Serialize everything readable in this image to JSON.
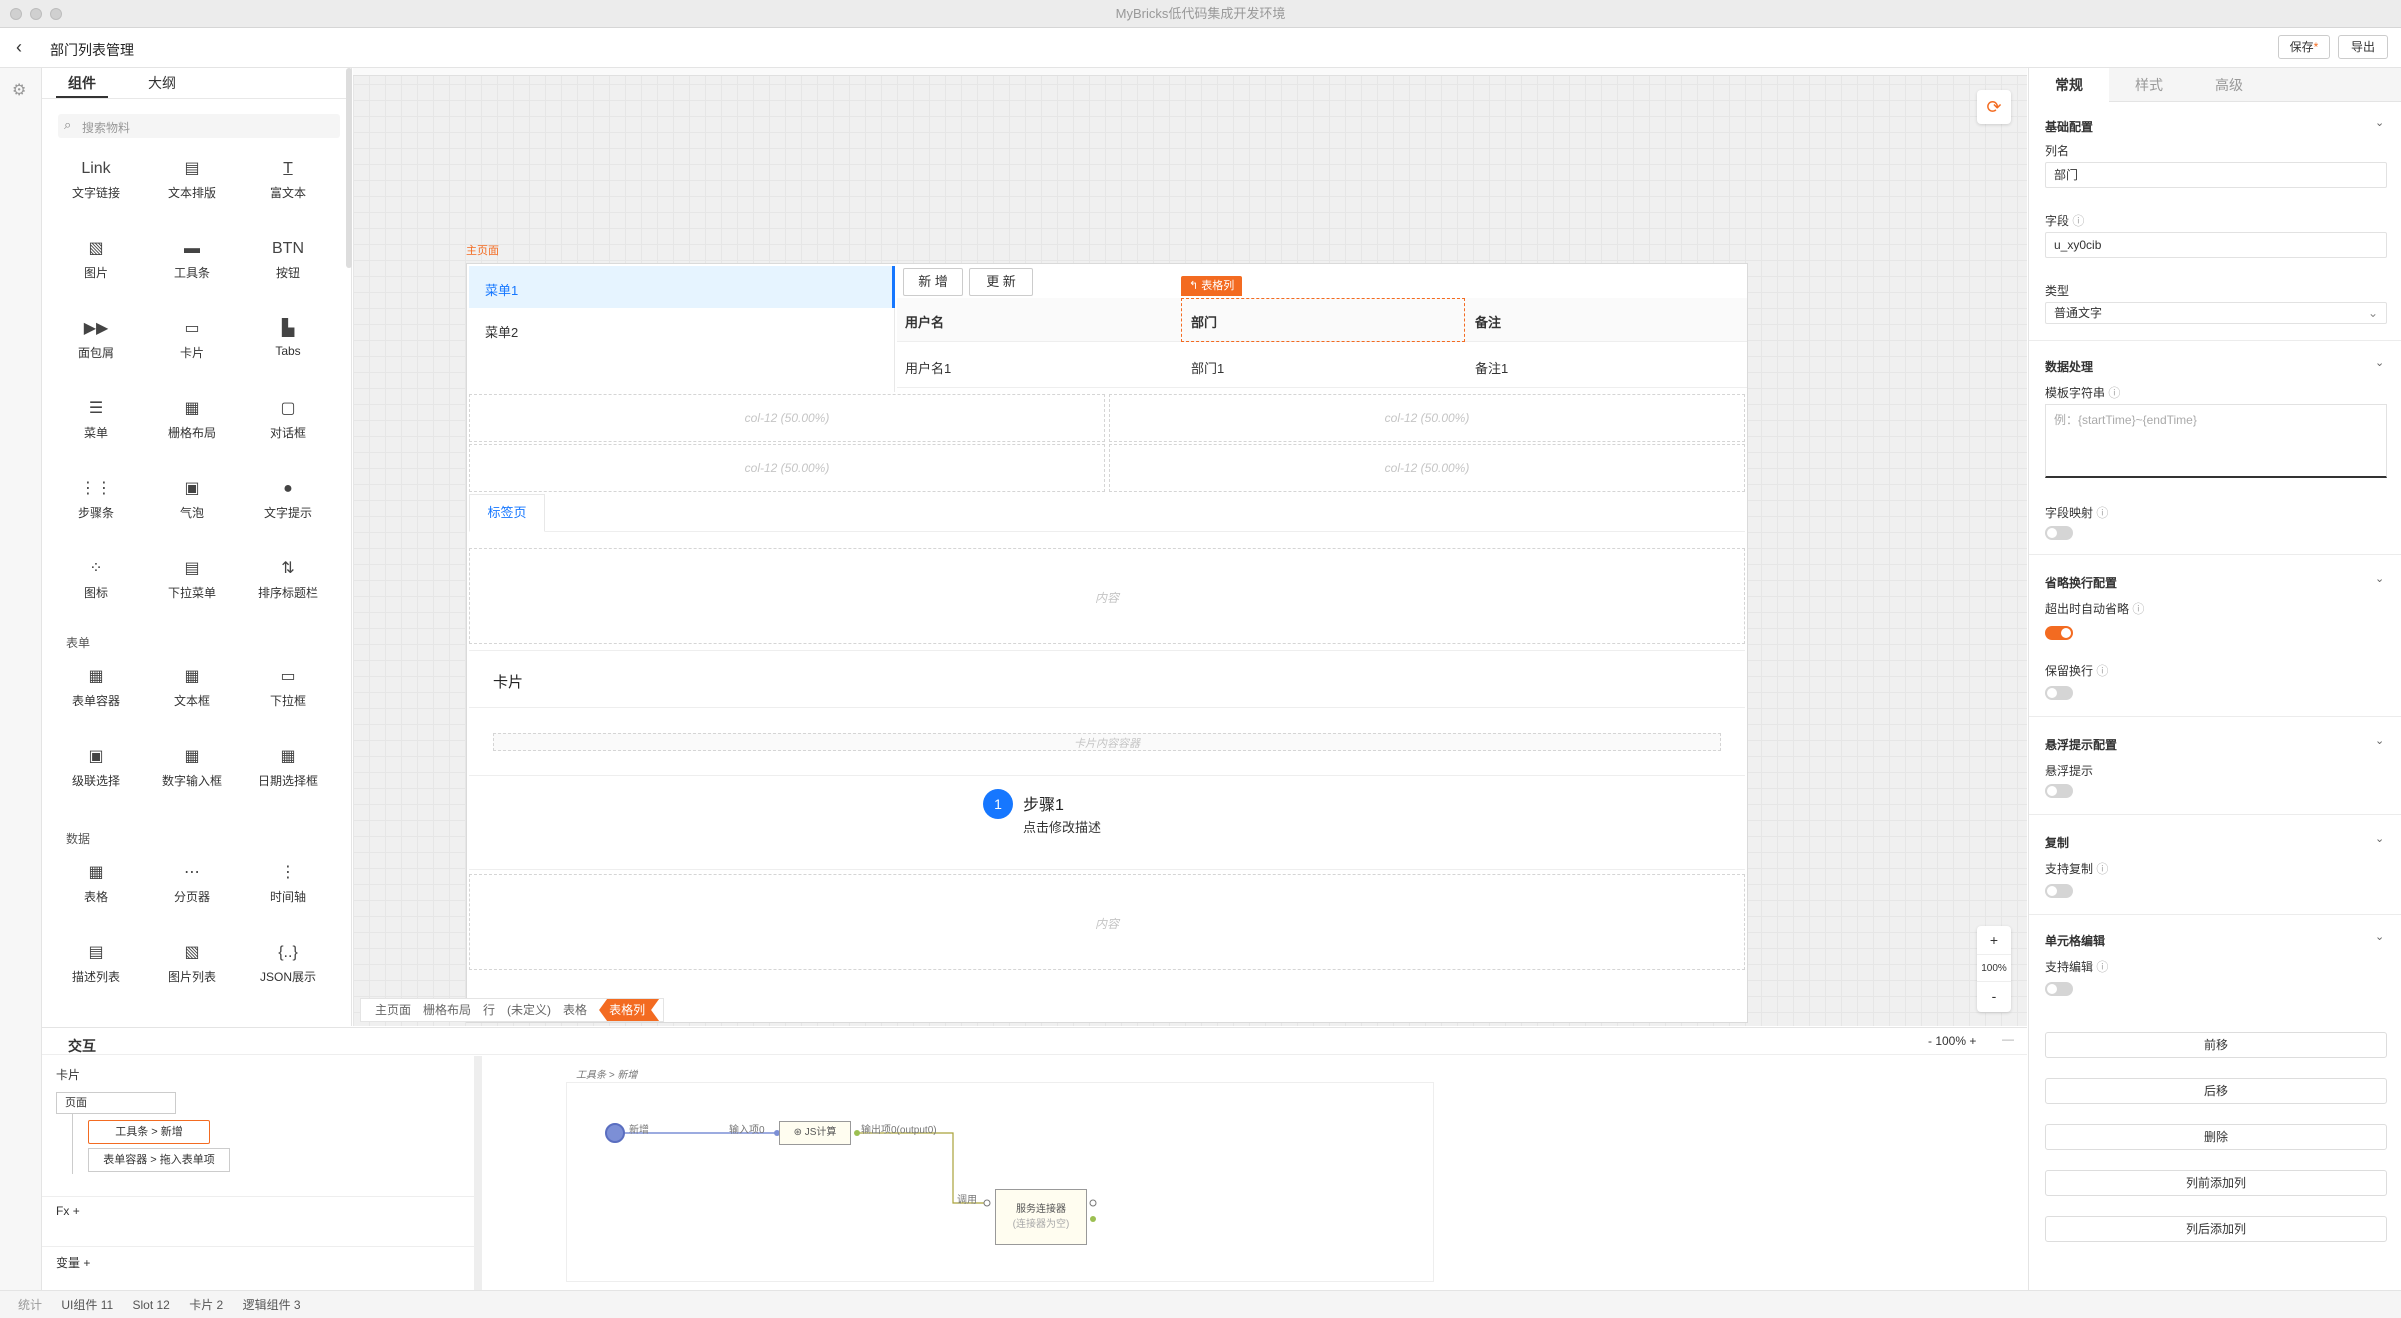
{
  "window": {
    "title": "MyBricks低代码集成开发环境"
  },
  "header": {
    "back_icon": "chevron-left-icon",
    "page_title": "部门列表管理",
    "save_label": "保存",
    "export_label": "导出"
  },
  "left_panel": {
    "tabs": [
      "组件",
      "大纲"
    ],
    "search_placeholder": "搜索物料",
    "components": [
      {
        "label": "文字链接",
        "icon": "Link"
      },
      {
        "label": "文本排版",
        "icon": "▤"
      },
      {
        "label": "富文本",
        "icon": "T̲"
      },
      {
        "label": "图片",
        "icon": "▧"
      },
      {
        "label": "工具条",
        "icon": "▬"
      },
      {
        "label": "按钮",
        "icon": "BTN"
      },
      {
        "label": "面包屑",
        "icon": "▶▶"
      },
      {
        "label": "卡片",
        "icon": "▭"
      },
      {
        "label": "Tabs",
        "icon": "▙"
      },
      {
        "label": "菜单",
        "icon": "☰"
      },
      {
        "label": "栅格布局",
        "icon": "▦"
      },
      {
        "label": "对话框",
        "icon": "▢"
      },
      {
        "label": "步骤条",
        "icon": "⋮⋮"
      },
      {
        "label": "气泡",
        "icon": "▣"
      },
      {
        "label": "文字提示",
        "icon": "●"
      },
      {
        "label": "图标",
        "icon": "⁘"
      },
      {
        "label": "下拉菜单",
        "icon": "▤"
      },
      {
        "label": "排序标题栏",
        "icon": "⇅"
      }
    ],
    "form_section": "表单",
    "form_components": [
      {
        "label": "表单容器",
        "icon": "▦"
      },
      {
        "label": "文本框",
        "icon": "▦"
      },
      {
        "label": "下拉框",
        "icon": "▭"
      },
      {
        "label": "级联选择",
        "icon": "▣"
      },
      {
        "label": "数字输入框",
        "icon": "▦"
      },
      {
        "label": "日期选择框",
        "icon": "▦"
      }
    ],
    "data_section": "数据",
    "data_components": [
      {
        "label": "表格",
        "icon": "▦"
      },
      {
        "label": "分页器",
        "icon": "⋯"
      },
      {
        "label": "时间轴",
        "icon": "⋮"
      },
      {
        "label": "描述列表",
        "icon": "▤"
      },
      {
        "label": "图片列表",
        "icon": "▧"
      },
      {
        "label": "JSON展示",
        "icon": "{..}"
      }
    ]
  },
  "canvas": {
    "page_label": "主页面",
    "menu": [
      "菜单1",
      "菜单2"
    ],
    "toolbar": [
      "新 增",
      "更 新"
    ],
    "table_col_tag": "表格列",
    "table_headers": [
      "用户名",
      "部门",
      "备注"
    ],
    "table_row": [
      "用户名1",
      "部门1",
      "备注1"
    ],
    "grid_cells": [
      "col-12 (50.00%)",
      "col-12 (50.00%)",
      "col-12 (50.00%)",
      "col-12 (50.00%)"
    ],
    "tab_label": "标签页",
    "content_placeholder": "内容",
    "card_title": "卡片",
    "card_content_placeholder": "卡片内容容器",
    "step_number": "1",
    "step_title": "步骤1",
    "step_desc": "点击修改描述",
    "content_placeholder2": "内容",
    "breadcrumb": [
      "主页面",
      "栅格布局",
      "行",
      "(未定义)",
      "表格",
      "表格列"
    ],
    "zoom_in": "+",
    "zoom_level": "100%",
    "zoom_out": "-"
  },
  "interaction": {
    "title": "交互",
    "zoom": "- 100% +",
    "tree_section": "卡片",
    "tree_root": "页面",
    "tree_items": [
      "工具条 > 新增",
      "表单容器 > 拖入表单项"
    ],
    "fx_label": "Fx",
    "var_label": "变量",
    "flow_title": "工具条 > 新增",
    "node_start_label": "新增",
    "node_input_label": "输入项0",
    "node_js": "JS计算",
    "node_output_label": "输出项0(output0)",
    "node_call_label": "调用",
    "node_service": "服务连接器",
    "node_service_sub": "(连接器为空)"
  },
  "right_panel": {
    "tabs": [
      "常规",
      "样式",
      "高级"
    ],
    "basic_section": "基础配置",
    "col_name_label": "列名",
    "col_name_value": "部门",
    "field_label": "字段",
    "field_value": "u_xy0cib",
    "type_label": "类型",
    "type_value": "普通文字",
    "data_section": "数据处理",
    "template_label": "模板字符串",
    "template_placeholder": "例：{startTime}~{endTime}",
    "field_map_label": "字段映射",
    "ellipsis_section": "省略换行配置",
    "auto_ellipsis_label": "超出时自动省略",
    "keep_wrap_label": "保留换行",
    "tooltip_section": "悬浮提示配置",
    "tooltip_label": "悬浮提示",
    "copy_section": "复制",
    "copy_label": "支持复制",
    "edit_section": "单元格编辑",
    "edit_label": "支持编辑",
    "buttons": [
      "前移",
      "后移",
      "删除",
      "列前添加列",
      "列后添加列"
    ]
  },
  "status": {
    "label": "统计",
    "ui": "UI组件 11",
    "slot": "Slot 12",
    "card": "卡片 2",
    "logic": "逻辑组件 3"
  },
  "colors": {
    "accent": "#f36b21",
    "selected": "#e6f4ff",
    "link": "#1677ff"
  }
}
